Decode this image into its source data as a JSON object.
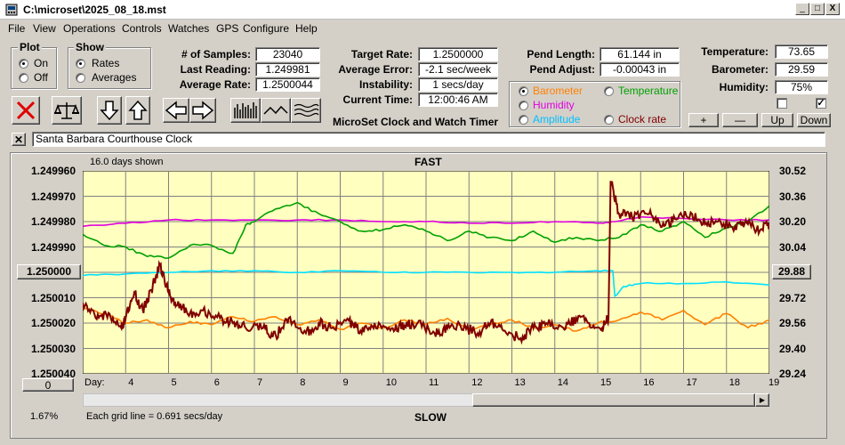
{
  "window": {
    "title": "C:\\microset\\2025_08_18.mst",
    "controls": [
      "_",
      "□",
      "X"
    ]
  },
  "menu": [
    "File",
    "View",
    "Operations",
    "Controls",
    "Watches",
    "GPS",
    "Configure",
    "Help"
  ],
  "plot_group": {
    "label": "Plot",
    "options": [
      "On",
      "Off"
    ],
    "selected": "On"
  },
  "show_group": {
    "label": "Show",
    "options": [
      "Rates",
      "Averages"
    ],
    "selected": "Rates"
  },
  "stats": {
    "samples_label": "# of Samples:",
    "samples": "23040",
    "last_label": "Last Reading:",
    "last": "1.249981",
    "avg_label": "Average Rate:",
    "avg": "1.2500044"
  },
  "targets": {
    "target_label": "Target Rate:",
    "target": "1.2500000",
    "avg_err_label": "Average Error:",
    "avg_err": "-2.1 sec/week",
    "instab_label": "Instability:",
    "instab": "1 secs/day",
    "time_label": "Current Time:",
    "time": "12:00:46 AM",
    "app_name": "MicroSet Clock and Watch Timer"
  },
  "pendulum": {
    "length_label": "Pend Length:",
    "length": "61.144 in",
    "adjust_label": "Pend Adjust:",
    "adjust": "-0.00043 in"
  },
  "series_select": {
    "options": [
      {
        "label": "Barometer",
        "color": "#ff8000",
        "selected": true
      },
      {
        "label": "Temperature",
        "color": "#00a000",
        "selected": false
      },
      {
        "label": "Humidity",
        "color": "#e000e0",
        "selected": false
      },
      {
        "label": "Amplitude",
        "color": "#00c0ff",
        "selected": false
      },
      {
        "label": "Clock rate",
        "color": "#800000",
        "selected": false
      }
    ]
  },
  "environment": {
    "temp_label": "Temperature:",
    "temp": "73.65",
    "baro_label": "Barometer:",
    "baro": "29.59",
    "hum_label": "Humidity:",
    "hum": "75%",
    "check1": false,
    "check2": true
  },
  "env_buttons": [
    "+",
    "—",
    "Up",
    "Down"
  ],
  "toolbar_icons": [
    "stop-icon",
    "balance-icon",
    "arrow-down-icon",
    "arrow-up-icon",
    "arrow-left-icon",
    "arrow-right-icon",
    "bars-icon",
    "wave-icon",
    "waves-icon"
  ],
  "clock_name": "Santa Barbara Courthouse Clock",
  "graph": {
    "days_shown": "16.0 days shown",
    "top_label": "FAST",
    "bottom_label": "SLOW",
    "grid_note": "Each grid line = 0.691 secs/day",
    "percent": "1.67%",
    "left_center_button": "1.250000",
    "right_center_button": "29.88",
    "left_bottom_button": "0",
    "day_label": "Day:",
    "colors": {
      "rate": "#800000",
      "barometer": "#ff8000",
      "temperature": "#00a000",
      "humidity": "#e000e0",
      "amplitude": "#00e0ff",
      "background": "#ffffc0",
      "grid": "#808080"
    }
  },
  "chart_data": {
    "type": "line",
    "title": "",
    "xlabel": "Day:",
    "x_ticks": [
      4,
      5,
      6,
      7,
      8,
      9,
      10,
      11,
      12,
      13,
      14,
      15,
      16,
      17,
      18,
      19
    ],
    "xlim": [
      3.0,
      19.0
    ],
    "y_left_ticks": [
      "1.249960",
      "1.249970",
      "1.249980",
      "1.249990",
      "1.250000",
      "1.250010",
      "1.250020",
      "1.250030",
      "1.250040"
    ],
    "y_left_lim": [
      1.24996,
      1.25004
    ],
    "y_left_inverted": true,
    "y_right_ticks": [
      "30.52",
      "30.36",
      "30.20",
      "30.04",
      "29.88",
      "29.72",
      "29.56",
      "29.40",
      "29.24"
    ],
    "y_right_lim": [
      29.24,
      30.52
    ],
    "series": [
      {
        "name": "Clock rate",
        "axis": "left",
        "points": [
          [
            3.0,
            1.250012
          ],
          [
            3.3,
            1.250018
          ],
          [
            3.6,
            1.250016
          ],
          [
            3.9,
            1.250022
          ],
          [
            4.0,
            1.250018
          ],
          [
            4.2,
            1.250008
          ],
          [
            4.4,
            1.250015
          ],
          [
            4.6,
            1.250007
          ],
          [
            4.8,
            1.249997
          ],
          [
            5.0,
            1.250008
          ],
          [
            5.2,
            1.250013
          ],
          [
            5.5,
            1.250016
          ],
          [
            5.8,
            1.250015
          ],
          [
            6.2,
            1.250018
          ],
          [
            6.5,
            1.25002
          ],
          [
            6.8,
            1.250022
          ],
          [
            7.2,
            1.250022
          ],
          [
            7.5,
            1.250025
          ],
          [
            7.8,
            1.250018
          ],
          [
            8.2,
            1.250024
          ],
          [
            8.5,
            1.25002
          ],
          [
            8.8,
            1.250022
          ],
          [
            9.2,
            1.250019
          ],
          [
            9.5,
            1.250024
          ],
          [
            9.8,
            1.25002
          ],
          [
            10.2,
            1.250022
          ],
          [
            10.5,
            1.250021
          ],
          [
            10.8,
            1.25002
          ],
          [
            11.2,
            1.250024
          ],
          [
            11.5,
            1.250022
          ],
          [
            11.8,
            1.250021
          ],
          [
            12.2,
            1.250024
          ],
          [
            12.5,
            1.25002
          ],
          [
            12.8,
            1.250023
          ],
          [
            13.2,
            1.250026
          ],
          [
            13.5,
            1.250022
          ],
          [
            13.8,
            1.25002
          ],
          [
            14.2,
            1.250022
          ],
          [
            14.5,
            1.250018
          ],
          [
            14.8,
            1.25002
          ],
          [
            15.1,
            1.250022
          ],
          [
            15.25,
            1.250018
          ],
          [
            15.3,
            1.249964
          ],
          [
            15.5,
            1.249977
          ],
          [
            15.8,
            1.249978
          ],
          [
            16.2,
            1.249977
          ],
          [
            16.5,
            1.249982
          ],
          [
            16.8,
            1.249979
          ],
          [
            17.2,
            1.249977
          ],
          [
            17.5,
            1.249981
          ],
          [
            17.8,
            1.24998
          ],
          [
            18.2,
            1.249982
          ],
          [
            18.5,
            1.249981
          ],
          [
            18.8,
            1.249983
          ],
          [
            19.0,
            1.249981
          ]
        ]
      },
      {
        "name": "Barometer",
        "axis": "right",
        "points": [
          [
            3.0,
            29.65
          ],
          [
            3.5,
            29.62
          ],
          [
            4.0,
            29.56
          ],
          [
            4.5,
            29.58
          ],
          [
            5.0,
            29.53
          ],
          [
            5.5,
            29.57
          ],
          [
            6.0,
            29.55
          ],
          [
            6.5,
            29.6
          ],
          [
            7.0,
            29.57
          ],
          [
            7.5,
            29.6
          ],
          [
            8.0,
            29.55
          ],
          [
            8.5,
            29.58
          ],
          [
            9.0,
            29.52
          ],
          [
            9.5,
            29.56
          ],
          [
            10.0,
            29.53
          ],
          [
            10.5,
            29.58
          ],
          [
            11.0,
            29.55
          ],
          [
            11.5,
            29.59
          ],
          [
            12.0,
            29.52
          ],
          [
            12.5,
            29.55
          ],
          [
            13.0,
            29.58
          ],
          [
            13.5,
            29.53
          ],
          [
            14.0,
            29.55
          ],
          [
            14.5,
            29.51
          ],
          [
            15.0,
            29.56
          ],
          [
            15.5,
            29.58
          ],
          [
            16.0,
            29.63
          ],
          [
            16.5,
            29.58
          ],
          [
            17.0,
            29.64
          ],
          [
            17.5,
            29.55
          ],
          [
            18.0,
            29.62
          ],
          [
            18.5,
            29.53
          ],
          [
            19.0,
            29.58
          ]
        ]
      },
      {
        "name": "Temperature",
        "axis": "right",
        "points": [
          [
            3.0,
            30.12
          ],
          [
            3.5,
            30.05
          ],
          [
            4.0,
            30.04
          ],
          [
            4.5,
            29.98
          ],
          [
            5.0,
            29.97
          ],
          [
            5.5,
            30.05
          ],
          [
            6.0,
            30.05
          ],
          [
            6.5,
            30.0
          ],
          [
            6.8,
            30.18
          ],
          [
            7.0,
            30.2
          ],
          [
            7.5,
            30.28
          ],
          [
            8.0,
            30.32
          ],
          [
            8.5,
            30.25
          ],
          [
            9.0,
            30.2
          ],
          [
            9.5,
            30.14
          ],
          [
            10.0,
            30.15
          ],
          [
            10.5,
            30.18
          ],
          [
            11.0,
            30.14
          ],
          [
            11.5,
            30.08
          ],
          [
            12.0,
            30.14
          ],
          [
            12.5,
            30.1
          ],
          [
            13.0,
            30.08
          ],
          [
            13.5,
            30.14
          ],
          [
            14.0,
            30.07
          ],
          [
            14.5,
            30.1
          ],
          [
            15.0,
            30.08
          ],
          [
            15.5,
            30.1
          ],
          [
            16.0,
            30.18
          ],
          [
            16.5,
            30.14
          ],
          [
            17.0,
            30.2
          ],
          [
            17.5,
            30.1
          ],
          [
            18.0,
            30.16
          ],
          [
            18.5,
            30.2
          ],
          [
            19.0,
            30.3
          ]
        ]
      },
      {
        "name": "Humidity",
        "axis": "right",
        "points": [
          [
            3.0,
            30.17
          ],
          [
            4.0,
            30.19
          ],
          [
            5.0,
            30.21
          ],
          [
            6.0,
            30.21
          ],
          [
            7.0,
            30.21
          ],
          [
            8.0,
            30.21
          ],
          [
            9.0,
            30.21
          ],
          [
            10.0,
            30.2
          ],
          [
            11.0,
            30.2
          ],
          [
            12.0,
            30.19
          ],
          [
            13.0,
            30.19
          ],
          [
            14.0,
            30.2
          ],
          [
            15.0,
            30.19
          ],
          [
            15.4,
            30.2
          ],
          [
            16.0,
            30.23
          ],
          [
            17.0,
            30.22
          ],
          [
            18.0,
            30.21
          ],
          [
            19.0,
            30.21
          ]
        ]
      },
      {
        "name": "Amplitude",
        "axis": "right",
        "points": [
          [
            3.0,
            29.86
          ],
          [
            4.0,
            29.87
          ],
          [
            5.0,
            29.88
          ],
          [
            6.0,
            29.89
          ],
          [
            7.0,
            29.89
          ],
          [
            8.0,
            29.88
          ],
          [
            9.0,
            29.89
          ],
          [
            10.0,
            29.88
          ],
          [
            11.0,
            29.88
          ],
          [
            12.0,
            29.88
          ],
          [
            13.0,
            29.88
          ],
          [
            14.0,
            29.88
          ],
          [
            15.0,
            29.89
          ],
          [
            15.35,
            29.89
          ],
          [
            15.4,
            29.73
          ],
          [
            15.6,
            29.79
          ],
          [
            16.0,
            29.81
          ],
          [
            17.0,
            29.81
          ],
          [
            18.0,
            29.82
          ],
          [
            19.0,
            29.8
          ]
        ]
      }
    ]
  }
}
